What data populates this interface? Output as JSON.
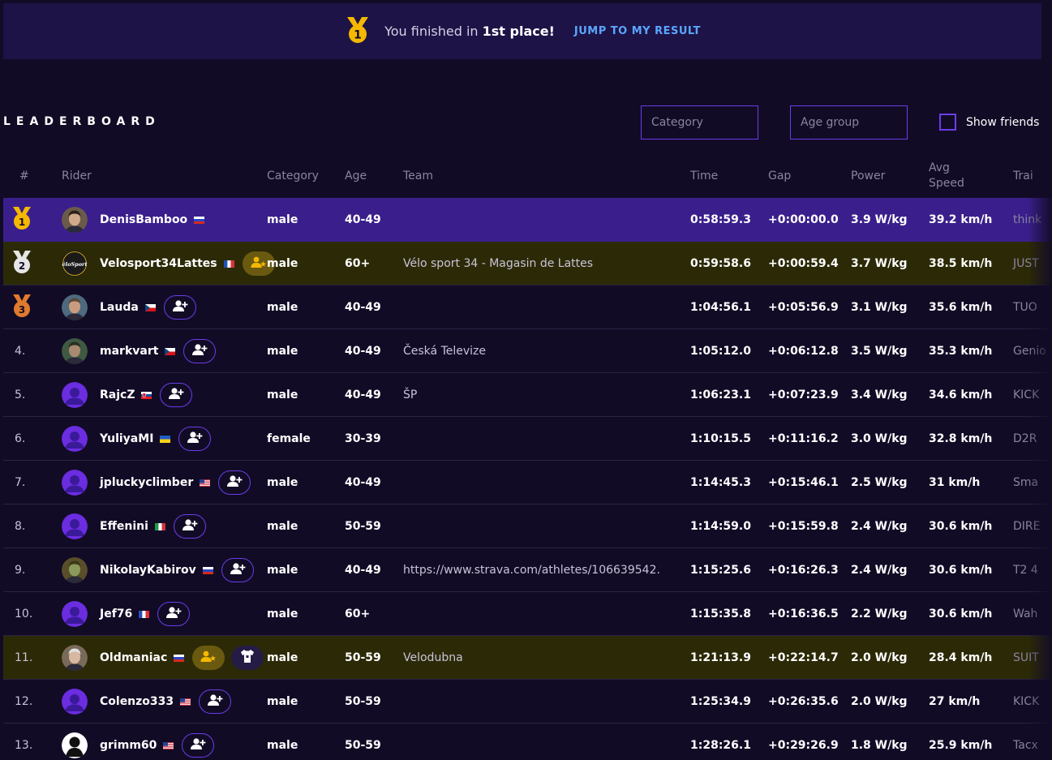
{
  "banner": {
    "message_prefix": "You finished in ",
    "message_place": "1st place!",
    "jump_label": "JUMP TO MY RESULT"
  },
  "leaderboard": {
    "title": "LEADERBOARD",
    "category_placeholder": "Category",
    "age_placeholder": "Age group",
    "friends_label": "Show friends"
  },
  "columns": {
    "pos": "#",
    "rider": "Rider",
    "category": "Category",
    "age": "Age",
    "team": "Team",
    "time": "Time",
    "gap": "Gap",
    "power": "Power",
    "speed_line1": "Avg",
    "speed_line2": "Speed",
    "trainer": "Trai"
  },
  "rows": [
    {
      "pos": "1",
      "name": "DenisBamboo",
      "flag": "ru",
      "category": "male",
      "age": "40-49",
      "team": "",
      "time": "0:58:59.3",
      "gap": "+0:00:00.0",
      "power": "3.9 W/kg",
      "speed": "39.2 km/h",
      "trainer": "think"
    },
    {
      "pos": "2",
      "name": "Velosport34Lattes",
      "flag": "fr",
      "category": "male",
      "age": "60+",
      "team": "Vélo sport 34 - Magasin de Lattes",
      "time": "0:59:58.6",
      "gap": "+0:00:59.4",
      "power": "3.7 W/kg",
      "speed": "38.5 km/h",
      "trainer": "JUST",
      "avatar_text": "éloSport"
    },
    {
      "pos": "3",
      "name": "Lauda",
      "flag": "cz",
      "category": "male",
      "age": "40-49",
      "team": "",
      "time": "1:04:56.1",
      "gap": "+0:05:56.9",
      "power": "3.1 W/kg",
      "speed": "35.6 km/h",
      "trainer": "TUO"
    },
    {
      "pos": "4.",
      "name": "markvart",
      "flag": "cz",
      "category": "male",
      "age": "40-49",
      "team": "Česká Televize",
      "time": "1:05:12.0",
      "gap": "+0:06:12.8",
      "power": "3.5 W/kg",
      "speed": "35.3 km/h",
      "trainer": "Genio"
    },
    {
      "pos": "5.",
      "name": "RajcZ",
      "flag": "sk",
      "category": "male",
      "age": "40-49",
      "team": "ŠP",
      "time": "1:06:23.1",
      "gap": "+0:07:23.9",
      "power": "3.4 W/kg",
      "speed": "34.6 km/h",
      "trainer": "KICK"
    },
    {
      "pos": "6.",
      "name": "YuliyaMI",
      "flag": "ua",
      "category": "female",
      "age": "30-39",
      "team": "",
      "time": "1:10:15.5",
      "gap": "+0:11:16.2",
      "power": "3.0 W/kg",
      "speed": "32.8 km/h",
      "trainer": "D2R"
    },
    {
      "pos": "7.",
      "name": "jpluckyclimber",
      "flag": "us",
      "category": "male",
      "age": "40-49",
      "team": "",
      "time": "1:14:45.3",
      "gap": "+0:15:46.1",
      "power": "2.5 W/kg",
      "speed": "31 km/h",
      "trainer": "Sma"
    },
    {
      "pos": "8.",
      "name": "Effenini",
      "flag": "it",
      "category": "male",
      "age": "50-59",
      "team": "",
      "time": "1:14:59.0",
      "gap": "+0:15:59.8",
      "power": "2.4 W/kg",
      "speed": "30.6 km/h",
      "trainer": "DIRE"
    },
    {
      "pos": "9.",
      "name": "NikolayKabirov",
      "flag": "ru",
      "category": "male",
      "age": "40-49",
      "team": "https://www.strava.com/athletes/106639542.",
      "time": "1:15:25.6",
      "gap": "+0:16:26.3",
      "power": "2.4 W/kg",
      "speed": "30.6 km/h",
      "trainer": "T2 4"
    },
    {
      "pos": "10.",
      "name": "Jef76",
      "flag": "fr",
      "category": "male",
      "age": "60+",
      "team": "",
      "time": "1:15:35.8",
      "gap": "+0:16:36.5",
      "power": "2.2 W/kg",
      "speed": "30.6 km/h",
      "trainer": "Wah"
    },
    {
      "pos": "11.",
      "name": "Oldmaniac",
      "flag": "ru",
      "category": "male",
      "age": "50-59",
      "team": "Velodubna",
      "time": "1:21:13.9",
      "gap": "+0:22:14.7",
      "power": "2.0 W/kg",
      "speed": "28.4 km/h",
      "trainer": "SUIT"
    },
    {
      "pos": "12.",
      "name": "Colenzo333",
      "flag": "us",
      "category": "male",
      "age": "50-59",
      "team": "",
      "time": "1:25:34.9",
      "gap": "+0:26:35.6",
      "power": "2.0 W/kg",
      "speed": "27 km/h",
      "trainer": "KICK"
    },
    {
      "pos": "13.",
      "name": "grimm60",
      "flag": "us",
      "category": "male",
      "age": "50-59",
      "team": "",
      "time": "1:28:26.1",
      "gap": "+0:29:26.9",
      "power": "1.8 W/kg",
      "speed": "25.9 km/h",
      "trainer": "Tacx"
    }
  ],
  "colors": {
    "background": "#120b26",
    "banner": "#1e1347",
    "first_row": "#3a1f8c",
    "sponsor_row": "#2c2a06",
    "accent": "#6a3de8",
    "link": "#5aa6ff",
    "gold": "#f5b800",
    "silver": "#e6e6e6",
    "bronze": "#e07a2e"
  }
}
